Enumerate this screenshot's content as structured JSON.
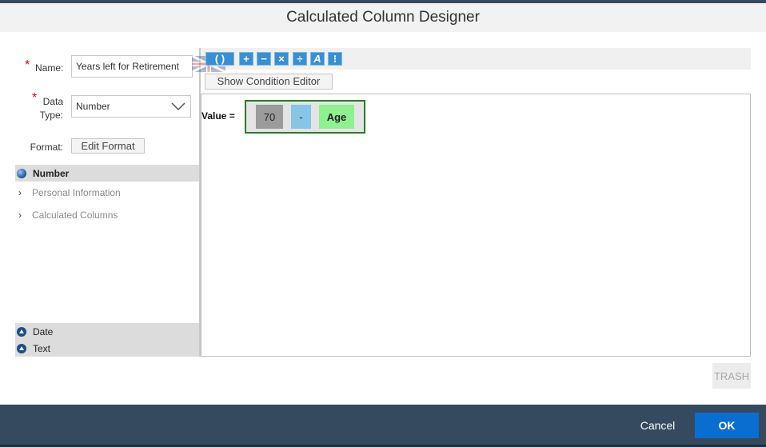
{
  "dialog": {
    "title": "Calculated Column Designer"
  },
  "form": {
    "required_mark": "*",
    "name_label": "Name:",
    "name_value": "Years left for Retirement",
    "data_label_line1": "Data",
    "data_label_line2": "Type:",
    "data_type_value": "Number",
    "format_label": "Format:",
    "edit_format_label": "Edit Format"
  },
  "tree": {
    "number_header": "Number",
    "items": [
      {
        "label": "Personal Information",
        "icon": "chevron-right-icon"
      },
      {
        "label": "Calculated Columns",
        "icon": "chevron-right-icon"
      }
    ],
    "date_header": "Date",
    "text_header": "Text"
  },
  "toolbar": {
    "buttons": [
      {
        "name": "parentheses-button",
        "glyph": "( )"
      },
      {
        "name": "plus-button",
        "glyph": "+"
      },
      {
        "name": "minus-button",
        "glyph": "−"
      },
      {
        "name": "multiply-button",
        "glyph": "×"
      },
      {
        "name": "divide-button",
        "glyph": "÷"
      },
      {
        "name": "function-button",
        "glyph": "A"
      },
      {
        "name": "condition-button",
        "glyph": "⁝"
      }
    ],
    "show_condition_label": "Show Condition Editor"
  },
  "expression": {
    "value_label": "Value =",
    "tokens": [
      "70",
      "-",
      "Age"
    ]
  },
  "trash_label": "TRASH",
  "footer": {
    "cancel_label": "Cancel",
    "ok_label": "OK"
  },
  "colors": {
    "header_dark": "#354a5f",
    "ok_blue": "#0a6ed1",
    "required_red": "#e00000",
    "expr_border": "#2a7a2a",
    "token_number": "#9b9b9b",
    "token_operator": "#87c4e6",
    "token_column": "#8ff08f"
  }
}
